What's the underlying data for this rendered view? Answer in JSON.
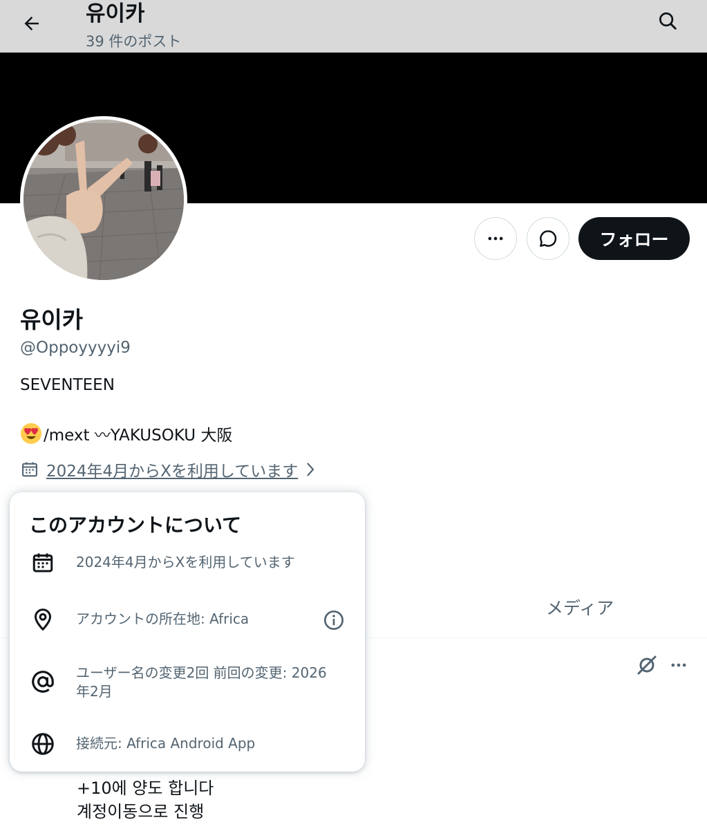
{
  "header": {
    "title": "유이카",
    "post_count": "39 件のポスト",
    "back_icon": "arrow-left-icon",
    "search_icon": "search-icon"
  },
  "profile": {
    "display_name": "유이카",
    "handle": "@Oppoyyyyi9",
    "bio_line1": "SEVENTEEN",
    "bio_line2": "/mext 〰YAKUSOKU 大阪",
    "bio_emoji": "heart-eyes-emoji",
    "joined": "2024年4月からXを利用しています",
    "follow_label": "フォロー"
  },
  "tabs": {
    "media_label": "メディア"
  },
  "post": {
    "line1": "+10에 양도 합니다",
    "line2": "계정이동으로 진행"
  },
  "about_popup": {
    "title": "このアカウントについて",
    "joined": "2024年4月からXを利用しています",
    "location": "アカウントの所在地: Africa",
    "username_changes": "ユーザー名の変更2回 前回の変更: 2026年2月",
    "connected_via": "接続元: Africa Android App"
  },
  "colors": {
    "header_bg": "#d9d9d9",
    "banner": "#000000",
    "primary_text": "#0f1419",
    "secondary_text": "#536471",
    "follow_bg": "#0f1419"
  }
}
